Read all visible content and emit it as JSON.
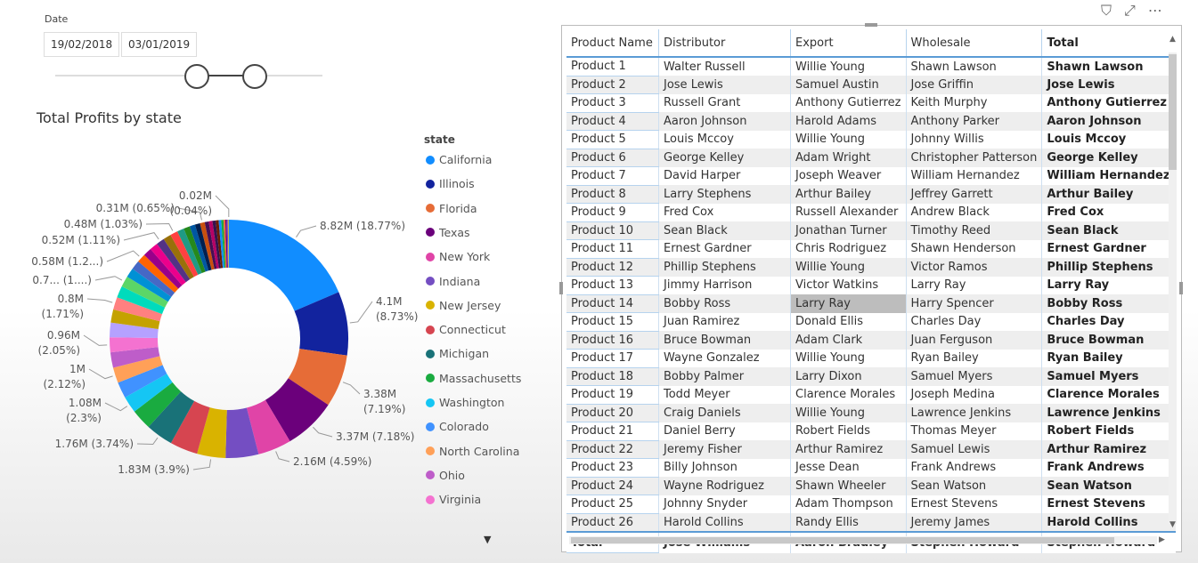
{
  "slicer": {
    "label": "Date",
    "start": "19/02/2018",
    "end": "03/01/2019"
  },
  "toolbar": {
    "filter_icon": "filter-icon",
    "focus_icon": "focus-mode-icon",
    "more_icon": "more-options-icon"
  },
  "chart_data": {
    "type": "pie",
    "title": "Total Profits by state",
    "legend_title": "state",
    "legend_position": "right",
    "donut": true,
    "slices": [
      {
        "name": "California",
        "percent": 18.77,
        "label": "8.82M (18.77%)",
        "color": "#118DFF"
      },
      {
        "name": "Illinois",
        "percent": 8.73,
        "label": "4.1M|(8.73%)",
        "color": "#12239E"
      },
      {
        "name": "Florida",
        "percent": 7.19,
        "label": "3.38M|(7.19%)",
        "color": "#E66C37"
      },
      {
        "name": "Texas",
        "percent": 7.18,
        "label": "3.37M (7.18%)",
        "color": "#6B007B"
      },
      {
        "name": "New York",
        "percent": 4.59,
        "label": "2.16M (4.59%)",
        "color": "#E044A7"
      },
      {
        "name": "Indiana",
        "percent": 4.5,
        "color": "#744EC2"
      },
      {
        "name": "New Jersey",
        "percent": 3.9,
        "label": "1.83M (3.9%)",
        "color": "#D9B300"
      },
      {
        "name": "Connecticut",
        "percent": 3.8,
        "color": "#D64550"
      },
      {
        "name": "Michigan",
        "percent": 3.74,
        "label": "1.76M (3.74%)",
        "color": "#197278"
      },
      {
        "name": "Massachusetts",
        "percent": 2.8,
        "color": "#1AAB40"
      },
      {
        "name": "Washington",
        "percent": 2.3,
        "label": "1.08M|(2.3%)",
        "color": "#15C6F4"
      },
      {
        "name": "Colorado",
        "percent": 2.2,
        "color": "#4092FF"
      },
      {
        "name": "North Carolina",
        "percent": 2.12,
        "label": "1M|(2.12%)",
        "color": "#FFA058"
      },
      {
        "name": "Ohio",
        "percent": 2.1,
        "color": "#BE5DC9"
      },
      {
        "name": "Virginia",
        "percent": 2.05,
        "label": "0.96M|(2.05%)",
        "color": "#F472D0"
      },
      {
        "percent": 2.0,
        "color": "#B5A1FF"
      },
      {
        "percent": 1.8,
        "color": "#C4A200"
      },
      {
        "percent": 1.71,
        "label": "0.8M|(1.71%)",
        "color": "#FF8080"
      },
      {
        "percent": 1.6,
        "color": "#00DBBC"
      },
      {
        "percent": 1.5,
        "label": "0.7... (1....)",
        "color": "#5BD667"
      },
      {
        "percent": 1.3,
        "color": "#0091D5"
      },
      {
        "percent": 1.25,
        "color": "#4668C5"
      },
      {
        "percent": 1.2,
        "label": "0.58M (1.2...)",
        "color": "#FF6300"
      },
      {
        "percent": 1.15,
        "color": "#99008A"
      },
      {
        "percent": 1.12,
        "color": "#EC008C"
      },
      {
        "percent": 1.11,
        "label": "0.52M (1.11%)",
        "color": "#533285"
      },
      {
        "percent": 1.08,
        "color": "#99700A"
      },
      {
        "percent": 1.03,
        "label": "0.48M (1.03%)",
        "color": "#FF4141"
      },
      {
        "percent": 0.95,
        "color": "#1F9A85"
      },
      {
        "percent": 0.85,
        "color": "#25891C"
      },
      {
        "percent": 0.75,
        "color": "#0057A2"
      },
      {
        "percent": 0.7,
        "color": "#002050"
      },
      {
        "percent": 0.65,
        "label": "0.31M (0.65%)",
        "color": "#C94F0F"
      },
      {
        "percent": 0.55,
        "color": "#450F54"
      },
      {
        "percent": 0.5,
        "color": "#B60064"
      },
      {
        "percent": 0.45,
        "color": "#34124F"
      },
      {
        "percent": 0.4,
        "color": "#6A1C00"
      },
      {
        "percent": 0.35,
        "color": "#118DFF"
      },
      {
        "percent": 0.3,
        "color": "#1AAB40"
      },
      {
        "percent": 0.25,
        "color": "#E66C37"
      },
      {
        "percent": 0.2,
        "color": "#6B007B"
      },
      {
        "percent": 0.15,
        "color": "#744EC2"
      },
      {
        "percent": 0.1,
        "color": "#D9B300"
      },
      {
        "percent": 0.04,
        "label": "0.02M|(0.04%)",
        "color": "#888888"
      }
    ]
  },
  "table": {
    "columns": [
      "Product Name",
      "Distributor",
      "Export",
      "Wholesale",
      "Total"
    ],
    "rows": [
      [
        "Product 1",
        "Walter Russell",
        "Willie Young",
        "Shawn Lawson",
        "Shawn Lawson"
      ],
      [
        "Product 2",
        "Jose Lewis",
        "Samuel Austin",
        "Jose Griffin",
        "Jose Lewis"
      ],
      [
        "Product 3",
        "Russell Grant",
        "Anthony Gutierrez",
        "Keith Murphy",
        "Anthony Gutierrez"
      ],
      [
        "Product 4",
        "Aaron Johnson",
        "Harold Adams",
        "Anthony Parker",
        "Aaron Johnson"
      ],
      [
        "Product 5",
        "Louis Mccoy",
        "Willie Young",
        "Johnny Willis",
        "Louis Mccoy"
      ],
      [
        "Product 6",
        "George Kelley",
        "Adam Wright",
        "Christopher Patterson",
        "George Kelley"
      ],
      [
        "Product 7",
        "David Harper",
        "Joseph Weaver",
        "William Hernandez",
        "William Hernandez"
      ],
      [
        "Product 8",
        "Larry Stephens",
        "Arthur Bailey",
        "Jeffrey Garrett",
        "Arthur Bailey"
      ],
      [
        "Product 9",
        "Fred Cox",
        "Russell Alexander",
        "Andrew Black",
        "Fred Cox"
      ],
      [
        "Product 10",
        "Sean Black",
        "Jonathan Turner",
        "Timothy Reed",
        "Sean Black"
      ],
      [
        "Product 11",
        "Ernest Gardner",
        "Chris Rodriguez",
        "Shawn Henderson",
        "Ernest Gardner"
      ],
      [
        "Product 12",
        "Phillip Stephens",
        "Willie Young",
        "Victor Ramos",
        "Phillip Stephens"
      ],
      [
        "Product 13",
        "Jimmy Harrison",
        "Victor Watkins",
        "Larry Ray",
        "Larry Ray"
      ],
      [
        "Product 14",
        "Bobby Ross",
        "Larry Ray",
        "Harry Spencer",
        "Bobby Ross"
      ],
      [
        "Product 15",
        "Juan Ramirez",
        "Donald Ellis",
        "Charles Day",
        "Charles Day"
      ],
      [
        "Product 16",
        "Bruce Bowman",
        "Adam Clark",
        "Juan Ferguson",
        "Bruce Bowman"
      ],
      [
        "Product 17",
        "Wayne Gonzalez",
        "Willie Young",
        "Ryan Bailey",
        "Ryan Bailey"
      ],
      [
        "Product 18",
        "Bobby Palmer",
        "Larry Dixon",
        "Samuel Myers",
        "Samuel Myers"
      ],
      [
        "Product 19",
        "Todd Meyer",
        "Clarence Morales",
        "Joseph Medina",
        "Clarence Morales"
      ],
      [
        "Product 20",
        "Craig Daniels",
        "Willie Young",
        "Lawrence Jenkins",
        "Lawrence Jenkins"
      ],
      [
        "Product 21",
        "Daniel Berry",
        "Robert Fields",
        "Thomas Meyer",
        "Robert Fields"
      ],
      [
        "Product 22",
        "Jeremy Fisher",
        "Arthur Ramirez",
        "Samuel Lewis",
        "Arthur Ramirez"
      ],
      [
        "Product 23",
        "Billy Johnson",
        "Jesse Dean",
        "Frank Andrews",
        "Frank Andrews"
      ],
      [
        "Product 24",
        "Wayne Rodriguez",
        "Shawn Wheeler",
        "Sean Watson",
        "Sean Watson"
      ],
      [
        "Product 25",
        "Johnny Snyder",
        "Adam Thompson",
        "Ernest Stevens",
        "Ernest Stevens"
      ],
      [
        "Product 26",
        "Harold Collins",
        "Randy Ellis",
        "Jeremy James",
        "Harold Collins"
      ]
    ],
    "total": [
      "Total",
      "Jose Williams",
      "Aaron Bradley",
      "Stephen Howard",
      "Stephen Howard"
    ],
    "hovered_cell": "Larry Ray"
  }
}
